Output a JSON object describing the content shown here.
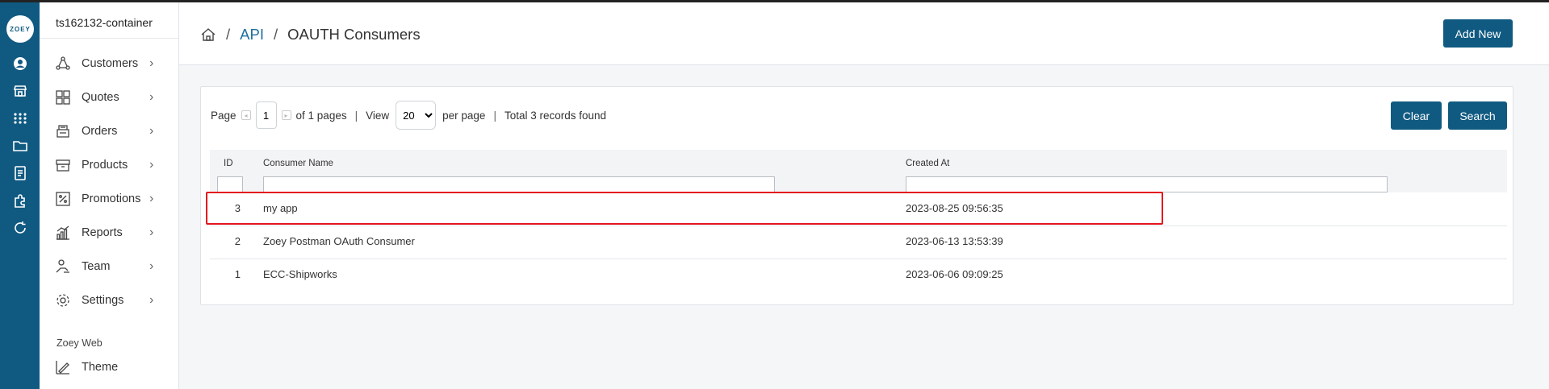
{
  "app": {
    "logo_text": "ZOEY",
    "store_name": "ts162132-container",
    "brand_color": "#105a82",
    "highlight_color": "#e3151e"
  },
  "rail": {
    "icons": [
      "user-circle-icon",
      "storefront-icon",
      "apps-grid-icon",
      "folder-icon",
      "document-icon",
      "puzzle-icon",
      "sync-icon"
    ]
  },
  "sidebar": {
    "items": [
      {
        "label": "Customers",
        "icon": "people-network-icon"
      },
      {
        "label": "Quotes",
        "icon": "quotes-grid-icon"
      },
      {
        "label": "Orders",
        "icon": "orders-box-icon"
      },
      {
        "label": "Products",
        "icon": "products-box-icon"
      },
      {
        "label": "Promotions",
        "icon": "percent-tag-icon"
      },
      {
        "label": "Reports",
        "icon": "bar-chart-icon"
      },
      {
        "label": "Team",
        "icon": "team-hand-icon"
      },
      {
        "label": "Settings",
        "icon": "gear-icon"
      }
    ],
    "section_label": "Zoey Web",
    "section_items": [
      {
        "label": "Theme",
        "icon": "theme-brush-icon"
      }
    ]
  },
  "header": {
    "breadcrumb": {
      "sep": "/",
      "api": "API",
      "current": "OAUTH Consumers"
    },
    "add_new_label": "Add New"
  },
  "grid": {
    "page_label": "Page",
    "page_value": "1",
    "of_pages": "of 1 pages",
    "bar": "|",
    "view_label": "View",
    "view_value": "20",
    "per_page": "per page",
    "total": "Total 3 records found",
    "clear_label": "Clear",
    "search_label": "Search",
    "columns": {
      "id": "ID",
      "name": "Consumer Name",
      "created": "Created At"
    },
    "rows": [
      {
        "id": "3",
        "name": "my app",
        "created": "2023-08-25 09:56:35"
      },
      {
        "id": "2",
        "name": "Zoey Postman OAuth Consumer",
        "created": "2023-06-13 13:53:39"
      },
      {
        "id": "1",
        "name": "ECC-Shipworks",
        "created": "2023-06-06 09:09:25"
      }
    ]
  }
}
